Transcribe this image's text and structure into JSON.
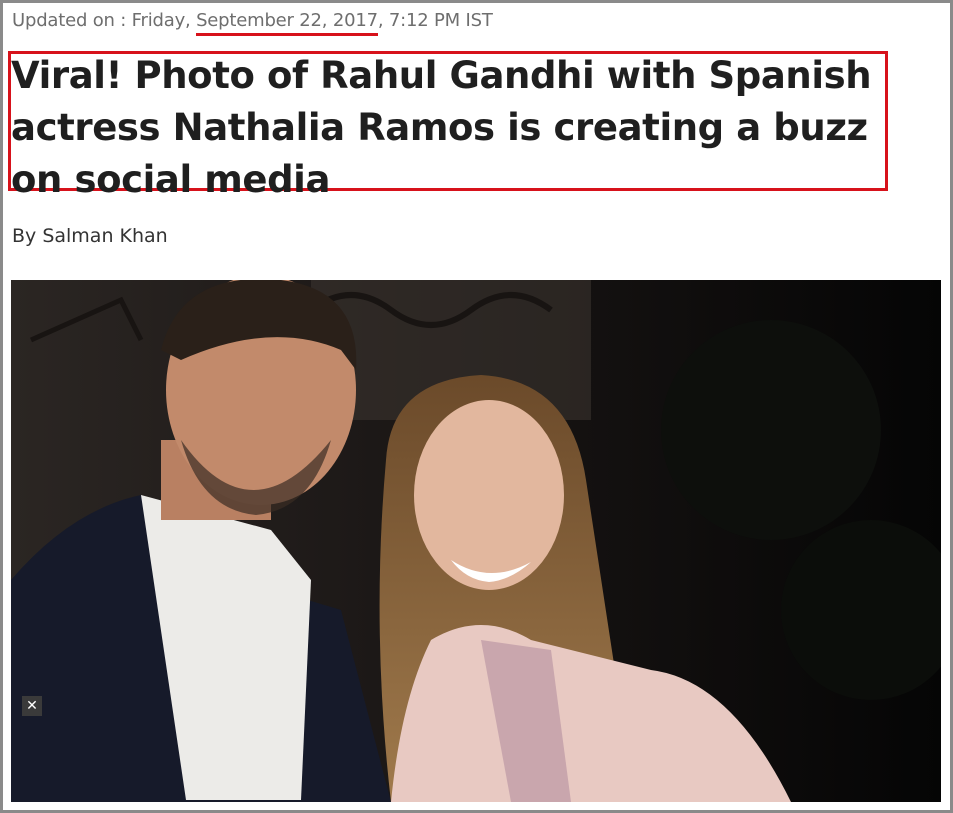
{
  "article": {
    "updated_prefix": "Updated on : Friday, ",
    "updated_date": "September 22, 2017",
    "updated_suffix": ", 7:12 PM IST",
    "headline": "Viral! Photo of Rahul Gandhi with Spanish actress Nathalia Ramos is creating a buzz on social media",
    "byline": "By Salman Khan"
  },
  "ad": {
    "close_glyph": "✕",
    "close_icon": "close-icon"
  },
  "colors": {
    "highlight": "#d7121b",
    "frame": "#8a8a8a",
    "text": "#1f1f1f"
  }
}
